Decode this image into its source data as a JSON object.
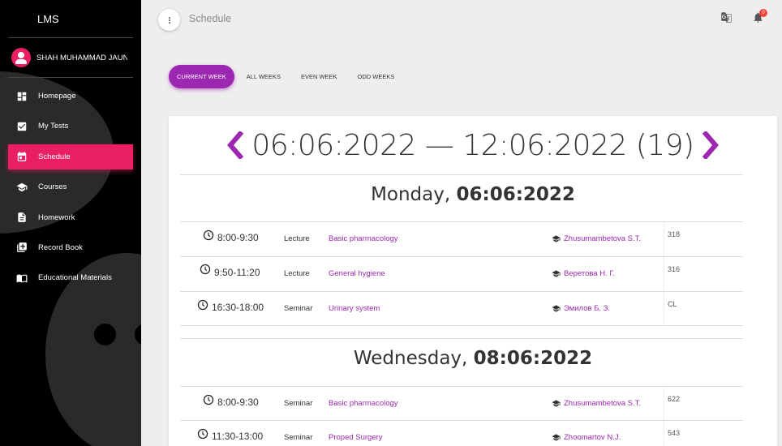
{
  "app": {
    "brand": "LMS"
  },
  "user": {
    "name": "SHAH MUHAMMAD JAUN"
  },
  "sidebar": {
    "items": [
      {
        "label": "Homepage",
        "icon": "dashboard-icon",
        "active": false
      },
      {
        "label": "My Tests",
        "icon": "checkbox-icon",
        "active": false
      },
      {
        "label": "Schedule",
        "icon": "calendar-icon",
        "active": true
      },
      {
        "label": "Courses",
        "icon": "graduation-cap-icon",
        "active": false
      },
      {
        "label": "Homework",
        "icon": "document-icon",
        "active": false
      },
      {
        "label": "Record Book",
        "icon": "record-book-icon",
        "active": false
      },
      {
        "label": "Educational Materials",
        "icon": "book-icon",
        "active": false
      }
    ]
  },
  "header": {
    "title": "Schedule",
    "notifications_count": "0"
  },
  "tabs": [
    {
      "label": "CURRENT WEEK",
      "active": true
    },
    {
      "label": "ALL WEEKS",
      "active": false
    },
    {
      "label": "EVEN WEEK",
      "active": false
    },
    {
      "label": "ODD WEEKS",
      "active": false
    }
  ],
  "schedule": {
    "week_range": "06:06:2022 — 12:06:2022 (19)",
    "days": [
      {
        "weekday": "Monday,",
        "date": "06:06:2022",
        "lessons": [
          {
            "time": "8:00-9:30",
            "type": "Lecture",
            "subject": "Basic pharmacology",
            "teacher": "Zhusumambetova S.T.",
            "room": "318"
          },
          {
            "time": "9:50-11:20",
            "type": "Lecture",
            "subject": "General hygiene",
            "teacher": "Веретова Н. Г.",
            "room": "316"
          },
          {
            "time": "16:30-18:00",
            "type": "Seminar",
            "subject": "Urinary system",
            "teacher": "Эмилов Б. З.",
            "room": "CL"
          }
        ]
      },
      {
        "weekday": "Wednesday,",
        "date": "08:06:2022",
        "lessons": [
          {
            "time": "8:00-9:30",
            "type": "Seminar",
            "subject": "Basic pharmacology",
            "teacher": "Zhusumambetova S.T.",
            "room": "622"
          },
          {
            "time": "11:30-13:00",
            "type": "Seminar",
            "subject": "Proped Surgery",
            "teacher": "Zhoomartov N.J.",
            "room": "543"
          }
        ]
      }
    ]
  },
  "colors": {
    "accent": "#e91e63",
    "primary": "#9c27b0",
    "sidebar_bg": "#000000"
  }
}
